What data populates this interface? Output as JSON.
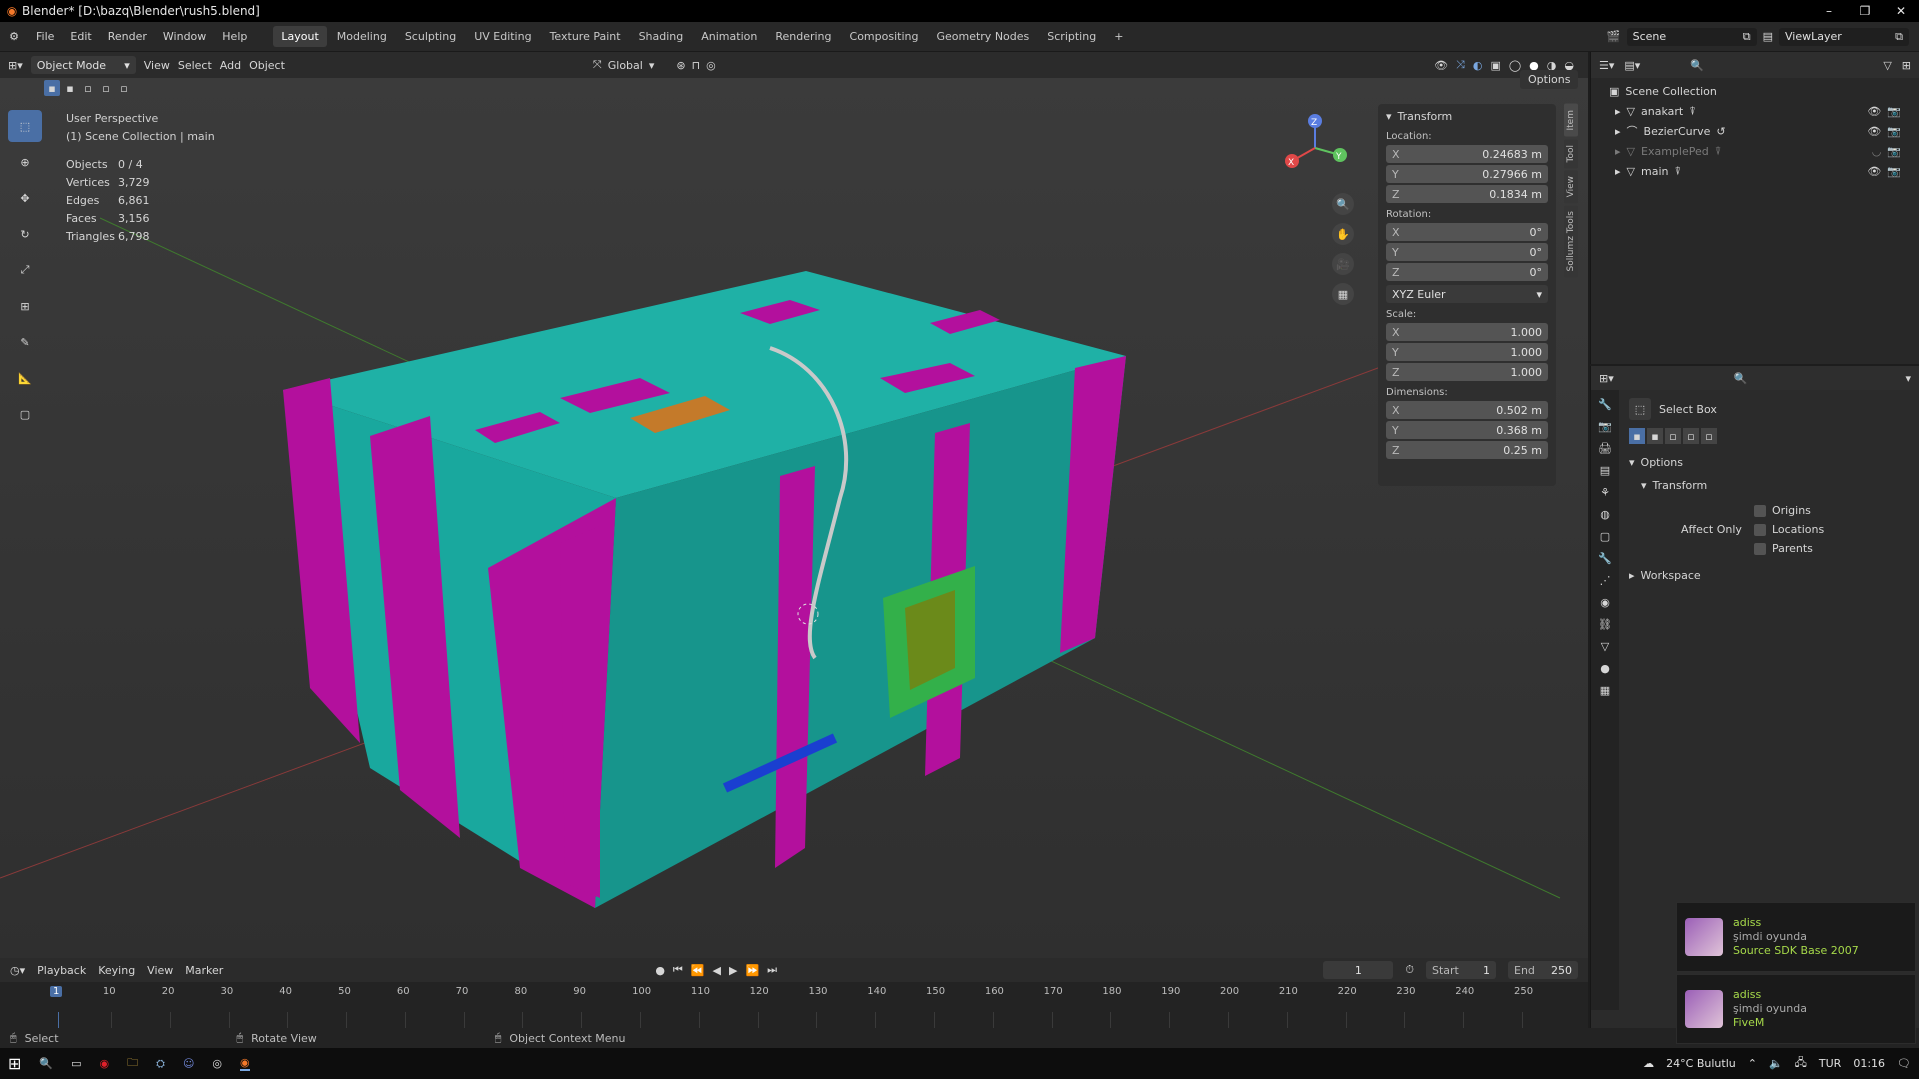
{
  "window": {
    "title": "Blender* [D:\\bazq\\Blender\\rush5.blend]",
    "controls": [
      "–",
      "❐",
      "✕"
    ]
  },
  "menu": {
    "items": [
      "File",
      "Edit",
      "Render",
      "Window",
      "Help"
    ],
    "workspaces": [
      "Layout",
      "Modeling",
      "Sculpting",
      "UV Editing",
      "Texture Paint",
      "Shading",
      "Animation",
      "Rendering",
      "Compositing",
      "Geometry Nodes",
      "Scripting"
    ],
    "add_tab": "+",
    "scene": "Scene",
    "view_layer": "ViewLayer"
  },
  "viewport_header": {
    "mode": "Object Mode",
    "menus": [
      "View",
      "Select",
      "Add",
      "Object"
    ],
    "orientation": "Global",
    "options": "Options"
  },
  "viewport": {
    "perspective": "User Perspective",
    "collection": "(1) Scene Collection | main",
    "stats": [
      {
        "label": "Objects",
        "value": "0 / 4"
      },
      {
        "label": "Vertices",
        "value": "3,729"
      },
      {
        "label": "Edges",
        "value": "6,861"
      },
      {
        "label": "Faces",
        "value": "3,156"
      },
      {
        "label": "Triangles",
        "value": "6,798"
      }
    ],
    "gizmo": {
      "x": "X",
      "y": "Y",
      "z": "Z"
    }
  },
  "npanel": {
    "title": "Transform",
    "location_label": "Location:",
    "location": [
      {
        "axis": "X",
        "value": "0.24683 m"
      },
      {
        "axis": "Y",
        "value": "0.27966 m"
      },
      {
        "axis": "Z",
        "value": "0.1834 m"
      }
    ],
    "rotation_label": "Rotation:",
    "rotation": [
      {
        "axis": "X",
        "value": "0°"
      },
      {
        "axis": "Y",
        "value": "0°"
      },
      {
        "axis": "Z",
        "value": "0°"
      }
    ],
    "rotation_mode": "XYZ Euler",
    "scale_label": "Scale:",
    "scale": [
      {
        "axis": "X",
        "value": "1.000"
      },
      {
        "axis": "Y",
        "value": "1.000"
      },
      {
        "axis": "Z",
        "value": "1.000"
      }
    ],
    "dimensions_label": "Dimensions:",
    "dimensions": [
      {
        "axis": "X",
        "value": "0.502 m"
      },
      {
        "axis": "Y",
        "value": "0.368 m"
      },
      {
        "axis": "Z",
        "value": "0.25 m"
      }
    ],
    "side_tabs": [
      "Item",
      "Tool",
      "View",
      "Sollumz Tools"
    ]
  },
  "outliner": {
    "root": "Scene Collection",
    "items": [
      {
        "name": "anakart",
        "dim": false
      },
      {
        "name": "BezierCurve",
        "dim": false
      },
      {
        "name": "ExamplePed",
        "dim": true
      },
      {
        "name": "main",
        "dim": false
      }
    ]
  },
  "properties": {
    "tool_name": "Select Box",
    "options": "Options",
    "transform": "Transform",
    "affect_only": "Affect Only",
    "checkboxes": [
      "Origins",
      "Locations",
      "Parents"
    ],
    "workspace": "Workspace"
  },
  "timeline": {
    "menus": [
      "Playback",
      "Keying",
      "View",
      "Marker"
    ],
    "current_frame": "1",
    "start_label": "Start",
    "start": "1",
    "end_label": "End",
    "end": "250",
    "ticks": [
      "1",
      "10",
      "20",
      "30",
      "40",
      "50",
      "60",
      "70",
      "80",
      "90",
      "100",
      "110",
      "120",
      "130",
      "140",
      "150",
      "160",
      "170",
      "180",
      "190",
      "200",
      "210",
      "220",
      "230",
      "240",
      "250"
    ]
  },
  "status": {
    "select": "Select",
    "rotate": "Rotate View",
    "context": "Object Context Menu"
  },
  "notifications": [
    {
      "user": "adiss",
      "status": "şimdi oyunda",
      "game": "Source SDK Base 2007"
    },
    {
      "user": "adiss",
      "status": "şimdi oyunda",
      "game": "FiveM"
    }
  ],
  "taskbar": {
    "weather": "24°C  Bulutlu",
    "lang": "TUR",
    "time": "01:16"
  },
  "colors": {
    "accent": "#4a6fa5",
    "teal": "#20b2aa",
    "magenta": "#b0109b"
  }
}
